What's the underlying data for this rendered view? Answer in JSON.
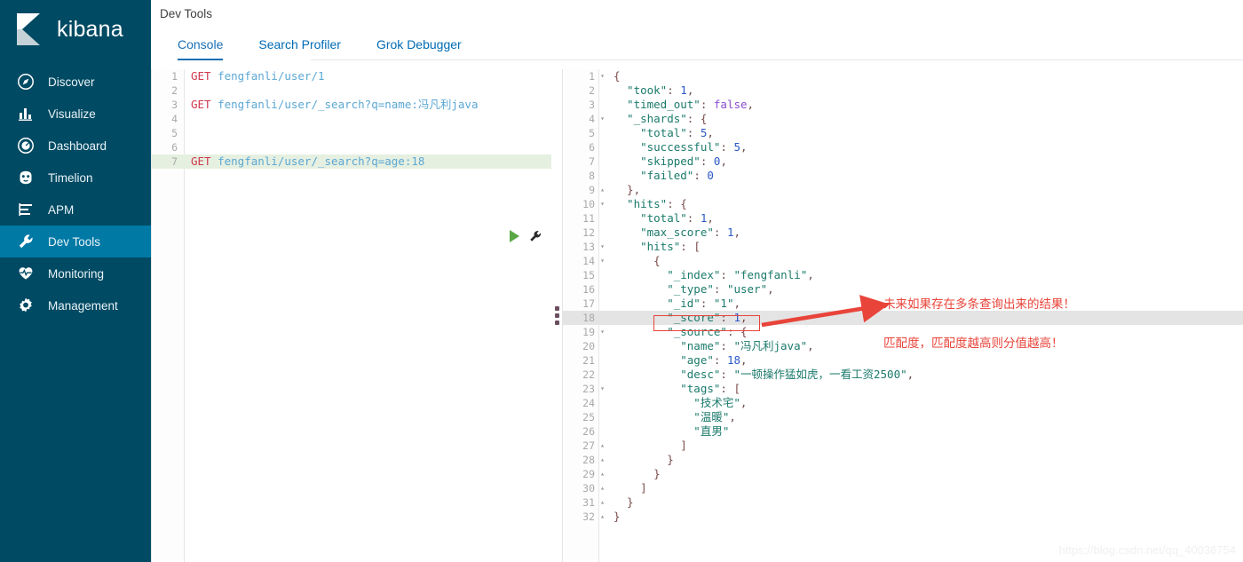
{
  "brand": {
    "name": "kibana",
    "logo_icon": "kibana-logo-icon"
  },
  "sidebar": {
    "items": [
      {
        "label": "Discover",
        "icon": "compass-icon",
        "active": false
      },
      {
        "label": "Visualize",
        "icon": "bar-chart-icon",
        "active": false
      },
      {
        "label": "Dashboard",
        "icon": "dashboard-icon",
        "active": false
      },
      {
        "label": "Timelion",
        "icon": "timelion-icon",
        "active": false
      },
      {
        "label": "APM",
        "icon": "apm-icon",
        "active": false
      },
      {
        "label": "Dev Tools",
        "icon": "wrench-icon",
        "active": true
      },
      {
        "label": "Monitoring",
        "icon": "heartbeat-icon",
        "active": false
      },
      {
        "label": "Management",
        "icon": "gear-icon",
        "active": false
      }
    ]
  },
  "header": {
    "title": "Dev Tools"
  },
  "tabs": [
    {
      "label": "Console",
      "active": true
    },
    {
      "label": "Search Profiler",
      "active": false
    },
    {
      "label": "Grok Debugger",
      "active": false
    }
  ],
  "editor": {
    "run_icon": "play-icon",
    "wrench_icon": "wrench-icon",
    "lines": [
      {
        "n": 1,
        "highlight": "none",
        "fold": "",
        "tokens": [
          {
            "c": "t-method",
            "t": "GET"
          },
          {
            "c": "t-url",
            "t": " fengfanli/user/1"
          }
        ]
      },
      {
        "n": 2,
        "highlight": "none",
        "fold": "",
        "tokens": []
      },
      {
        "n": 3,
        "highlight": "none",
        "fold": "",
        "tokens": [
          {
            "c": "t-method",
            "t": "GET"
          },
          {
            "c": "t-url",
            "t": " fengfanli/user/_search?q=name:冯凡利java"
          }
        ]
      },
      {
        "n": 4,
        "highlight": "none",
        "fold": "",
        "tokens": []
      },
      {
        "n": 5,
        "highlight": "none",
        "fold": "",
        "tokens": []
      },
      {
        "n": 6,
        "highlight": "none",
        "fold": "",
        "tokens": []
      },
      {
        "n": 7,
        "highlight": "green",
        "fold": "",
        "tokens": [
          {
            "c": "t-method",
            "t": "GET"
          },
          {
            "c": "t-url",
            "t": " fengfanli/user/_search?q=age:18"
          }
        ]
      }
    ]
  },
  "response": {
    "lines": [
      {
        "n": 1,
        "fold": "▾",
        "highlight": "none",
        "tokens": [
          {
            "c": "t-brace",
            "t": "{"
          }
        ]
      },
      {
        "n": 2,
        "fold": "",
        "highlight": "none",
        "tokens": [
          {
            "c": "t-key",
            "t": "  \"took\""
          },
          {
            "c": "t-punct",
            "t": ": "
          },
          {
            "c": "t-num",
            "t": "1"
          },
          {
            "c": "t-punct",
            "t": ","
          }
        ]
      },
      {
        "n": 3,
        "fold": "",
        "highlight": "none",
        "tokens": [
          {
            "c": "t-key",
            "t": "  \"timed_out\""
          },
          {
            "c": "t-punct",
            "t": ": "
          },
          {
            "c": "t-bool",
            "t": "false"
          },
          {
            "c": "t-punct",
            "t": ","
          }
        ]
      },
      {
        "n": 4,
        "fold": "▾",
        "highlight": "none",
        "tokens": [
          {
            "c": "t-key",
            "t": "  \"_shards\""
          },
          {
            "c": "t-punct",
            "t": ": "
          },
          {
            "c": "t-brace",
            "t": "{"
          }
        ]
      },
      {
        "n": 5,
        "fold": "",
        "highlight": "none",
        "tokens": [
          {
            "c": "t-key",
            "t": "    \"total\""
          },
          {
            "c": "t-punct",
            "t": ": "
          },
          {
            "c": "t-num",
            "t": "5"
          },
          {
            "c": "t-punct",
            "t": ","
          }
        ]
      },
      {
        "n": 6,
        "fold": "",
        "highlight": "none",
        "tokens": [
          {
            "c": "t-key",
            "t": "    \"successful\""
          },
          {
            "c": "t-punct",
            "t": ": "
          },
          {
            "c": "t-num",
            "t": "5"
          },
          {
            "c": "t-punct",
            "t": ","
          }
        ]
      },
      {
        "n": 7,
        "fold": "",
        "highlight": "none",
        "tokens": [
          {
            "c": "t-key",
            "t": "    \"skipped\""
          },
          {
            "c": "t-punct",
            "t": ": "
          },
          {
            "c": "t-num",
            "t": "0"
          },
          {
            "c": "t-punct",
            "t": ","
          }
        ]
      },
      {
        "n": 8,
        "fold": "",
        "highlight": "none",
        "tokens": [
          {
            "c": "t-key",
            "t": "    \"failed\""
          },
          {
            "c": "t-punct",
            "t": ": "
          },
          {
            "c": "t-num",
            "t": "0"
          }
        ]
      },
      {
        "n": 9,
        "fold": "▴",
        "highlight": "none",
        "tokens": [
          {
            "c": "t-brace",
            "t": "  }"
          },
          {
            "c": "t-punct",
            "t": ","
          }
        ]
      },
      {
        "n": 10,
        "fold": "▾",
        "highlight": "none",
        "tokens": [
          {
            "c": "t-key",
            "t": "  \"hits\""
          },
          {
            "c": "t-punct",
            "t": ": "
          },
          {
            "c": "t-brace",
            "t": "{"
          }
        ]
      },
      {
        "n": 11,
        "fold": "",
        "highlight": "none",
        "tokens": [
          {
            "c": "t-key",
            "t": "    \"total\""
          },
          {
            "c": "t-punct",
            "t": ": "
          },
          {
            "c": "t-num",
            "t": "1"
          },
          {
            "c": "t-punct",
            "t": ","
          }
        ]
      },
      {
        "n": 12,
        "fold": "",
        "highlight": "none",
        "tokens": [
          {
            "c": "t-key",
            "t": "    \"max_score\""
          },
          {
            "c": "t-punct",
            "t": ": "
          },
          {
            "c": "t-num",
            "t": "1"
          },
          {
            "c": "t-punct",
            "t": ","
          }
        ]
      },
      {
        "n": 13,
        "fold": "▾",
        "highlight": "none",
        "tokens": [
          {
            "c": "t-key",
            "t": "    \"hits\""
          },
          {
            "c": "t-punct",
            "t": ": "
          },
          {
            "c": "t-brace",
            "t": "["
          }
        ]
      },
      {
        "n": 14,
        "fold": "▾",
        "highlight": "none",
        "tokens": [
          {
            "c": "t-brace",
            "t": "      {"
          }
        ]
      },
      {
        "n": 15,
        "fold": "",
        "highlight": "none",
        "tokens": [
          {
            "c": "t-key",
            "t": "        \"_index\""
          },
          {
            "c": "t-punct",
            "t": ": "
          },
          {
            "c": "t-str",
            "t": "\"fengfanli\""
          },
          {
            "c": "t-punct",
            "t": ","
          }
        ]
      },
      {
        "n": 16,
        "fold": "",
        "highlight": "none",
        "tokens": [
          {
            "c": "t-key",
            "t": "        \"_type\""
          },
          {
            "c": "t-punct",
            "t": ": "
          },
          {
            "c": "t-str",
            "t": "\"user\""
          },
          {
            "c": "t-punct",
            "t": ","
          }
        ]
      },
      {
        "n": 17,
        "fold": "",
        "highlight": "none",
        "tokens": [
          {
            "c": "t-key",
            "t": "        \"_id\""
          },
          {
            "c": "t-punct",
            "t": ": "
          },
          {
            "c": "t-str",
            "t": "\"1\""
          },
          {
            "c": "t-punct",
            "t": ","
          }
        ]
      },
      {
        "n": 18,
        "fold": "",
        "highlight": "gray",
        "tokens": [
          {
            "c": "t-key",
            "t": "        \"_score\""
          },
          {
            "c": "t-punct",
            "t": ": "
          },
          {
            "c": "t-num",
            "t": "1"
          },
          {
            "c": "t-punct",
            "t": ","
          }
        ]
      },
      {
        "n": 19,
        "fold": "▾",
        "highlight": "none",
        "tokens": [
          {
            "c": "t-key",
            "t": "        \"_source\""
          },
          {
            "c": "t-punct",
            "t": ": "
          },
          {
            "c": "t-brace",
            "t": "{"
          }
        ]
      },
      {
        "n": 20,
        "fold": "",
        "highlight": "none",
        "tokens": [
          {
            "c": "t-key",
            "t": "          \"name\""
          },
          {
            "c": "t-punct",
            "t": ": "
          },
          {
            "c": "t-str",
            "t": "\"冯凡利java\""
          },
          {
            "c": "t-punct",
            "t": ","
          }
        ]
      },
      {
        "n": 21,
        "fold": "",
        "highlight": "none",
        "tokens": [
          {
            "c": "t-key",
            "t": "          \"age\""
          },
          {
            "c": "t-punct",
            "t": ": "
          },
          {
            "c": "t-num",
            "t": "18"
          },
          {
            "c": "t-punct",
            "t": ","
          }
        ]
      },
      {
        "n": 22,
        "fold": "",
        "highlight": "none",
        "tokens": [
          {
            "c": "t-key",
            "t": "          \"desc\""
          },
          {
            "c": "t-punct",
            "t": ": "
          },
          {
            "c": "t-str",
            "t": "\"一顿操作猛如虎，一看工资2500\""
          },
          {
            "c": "t-punct",
            "t": ","
          }
        ]
      },
      {
        "n": 23,
        "fold": "▾",
        "highlight": "none",
        "tokens": [
          {
            "c": "t-key",
            "t": "          \"tags\""
          },
          {
            "c": "t-punct",
            "t": ": "
          },
          {
            "c": "t-brace",
            "t": "["
          }
        ]
      },
      {
        "n": 24,
        "fold": "",
        "highlight": "none",
        "tokens": [
          {
            "c": "t-str",
            "t": "            \"技术宅\""
          },
          {
            "c": "t-punct",
            "t": ","
          }
        ]
      },
      {
        "n": 25,
        "fold": "",
        "highlight": "none",
        "tokens": [
          {
            "c": "t-str",
            "t": "            \"温暖\""
          },
          {
            "c": "t-punct",
            "t": ","
          }
        ]
      },
      {
        "n": 26,
        "fold": "",
        "highlight": "none",
        "tokens": [
          {
            "c": "t-str",
            "t": "            \"直男\""
          }
        ]
      },
      {
        "n": 27,
        "fold": "▴",
        "highlight": "none",
        "tokens": [
          {
            "c": "t-brace",
            "t": "          ]"
          }
        ]
      },
      {
        "n": 28,
        "fold": "▴",
        "highlight": "none",
        "tokens": [
          {
            "c": "t-brace",
            "t": "        }"
          }
        ]
      },
      {
        "n": 29,
        "fold": "▴",
        "highlight": "none",
        "tokens": [
          {
            "c": "t-brace",
            "t": "      }"
          }
        ]
      },
      {
        "n": 30,
        "fold": "▴",
        "highlight": "none",
        "tokens": [
          {
            "c": "t-brace",
            "t": "    ]"
          }
        ]
      },
      {
        "n": 31,
        "fold": "▴",
        "highlight": "none",
        "tokens": [
          {
            "c": "t-brace",
            "t": "  }"
          }
        ]
      },
      {
        "n": 32,
        "fold": "▴",
        "highlight": "none",
        "tokens": [
          {
            "c": "t-brace",
            "t": "}"
          }
        ]
      }
    ]
  },
  "annotation": {
    "line1": "未来如果存在多条查询出来的结果！",
    "line2": "匹配度，匹配度越高则分值越高！",
    "color": "#e8443a"
  },
  "watermark": {
    "text": "https://blog.csdn.net/qq_40036754"
  },
  "colors": {
    "sidebar_bg": "#014a63",
    "sidebar_active": "#0079a5",
    "tab_accent": "#1a6fb4",
    "run_green": "#5aa845",
    "annotation_red": "#e8443a"
  }
}
